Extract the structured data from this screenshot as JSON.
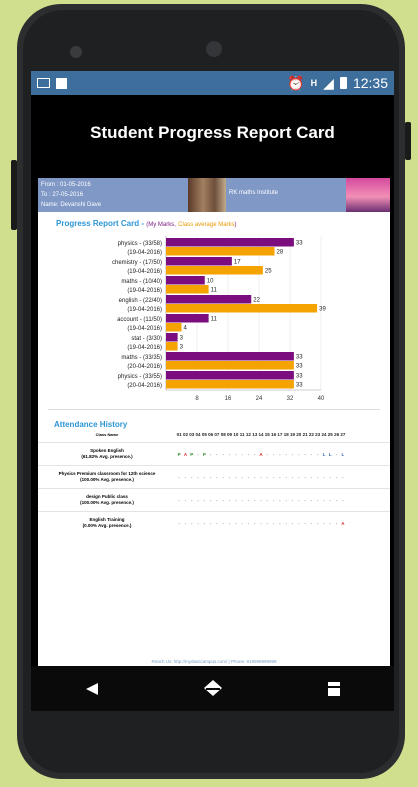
{
  "statusbar": {
    "time": "12:35",
    "network": "H"
  },
  "app": {
    "title": "Student Progress Report Card"
  },
  "info": {
    "from": "From : 01-05-2016",
    "to": "To : 27-05-2016",
    "name": "Name: Devanshi Dave",
    "institute": "RK maths Institute"
  },
  "report": {
    "title": "Progress Report Card -",
    "legend_open": "(",
    "my_marks": "My Marks,",
    "class_avg": "Class average Marks",
    "legend_close": ")"
  },
  "colors": {
    "my_marks": "#7b0d7e",
    "class_avg": "#f5a300",
    "accent": "#2d96d6"
  },
  "chart_data": {
    "type": "bar",
    "orientation": "horizontal",
    "categories": [
      [
        "physics - (33/58)",
        "(19-04-2016)"
      ],
      [
        "chemistry - (17/50)",
        "(19-04-2016)"
      ],
      [
        "maths - (10/40)",
        "(19-04-2016)"
      ],
      [
        "english - (22/40)",
        "(19-04-2016)"
      ],
      [
        "account - (11/50)",
        "(19-04-2016)"
      ],
      [
        "stat - (3/30)",
        "(19-04-2016)"
      ],
      [
        "maths - (33/35)",
        "(20-04-2016)"
      ],
      [
        "physics - (33/55)",
        "(20-04-2016)"
      ]
    ],
    "series": [
      {
        "name": "My Marks",
        "values": [
          33,
          17,
          10,
          22,
          11,
          3,
          33,
          33
        ]
      },
      {
        "name": "Class average Marks",
        "values": [
          28,
          25,
          11,
          39,
          4,
          3,
          33,
          33
        ]
      }
    ],
    "xticks": [
      "8",
      "16",
      "24",
      "32",
      "40"
    ],
    "xlim": [
      0,
      40
    ]
  },
  "attendance": {
    "title": "Attendance History",
    "column_header": "Class Name",
    "days": [
      "01",
      "02",
      "03",
      "04",
      "05",
      "06",
      "07",
      "08",
      "09",
      "10",
      "11",
      "12",
      "13",
      "14",
      "15",
      "16",
      "17",
      "18",
      "19",
      "20",
      "21",
      "22",
      "23",
      "24",
      "25",
      "26",
      "27"
    ],
    "rows": [
      {
        "name": "Spoken English",
        "pct": "(61.82% Avg. presence.)",
        "marks": {
          "1": "P",
          "2": "A",
          "3": "P",
          "5": "P",
          "14": "A",
          "24": "L",
          "25": "L",
          "27": "L"
        }
      },
      {
        "name": "Physics Premium classroom for 12th science",
        "pct": "(100.00% Avg. presence.)",
        "marks": {}
      },
      {
        "name": "design Public class",
        "pct": "(100.00% Avg. presence.)",
        "marks": {}
      },
      {
        "name": "English Training",
        "pct": "(0.00% Avg. presence.)",
        "marks": {
          "27": "A"
        }
      }
    ]
  },
  "footer": {
    "text": "Reach Us: http://mydasscampus.com/  |  Phone: 919999999999"
  }
}
